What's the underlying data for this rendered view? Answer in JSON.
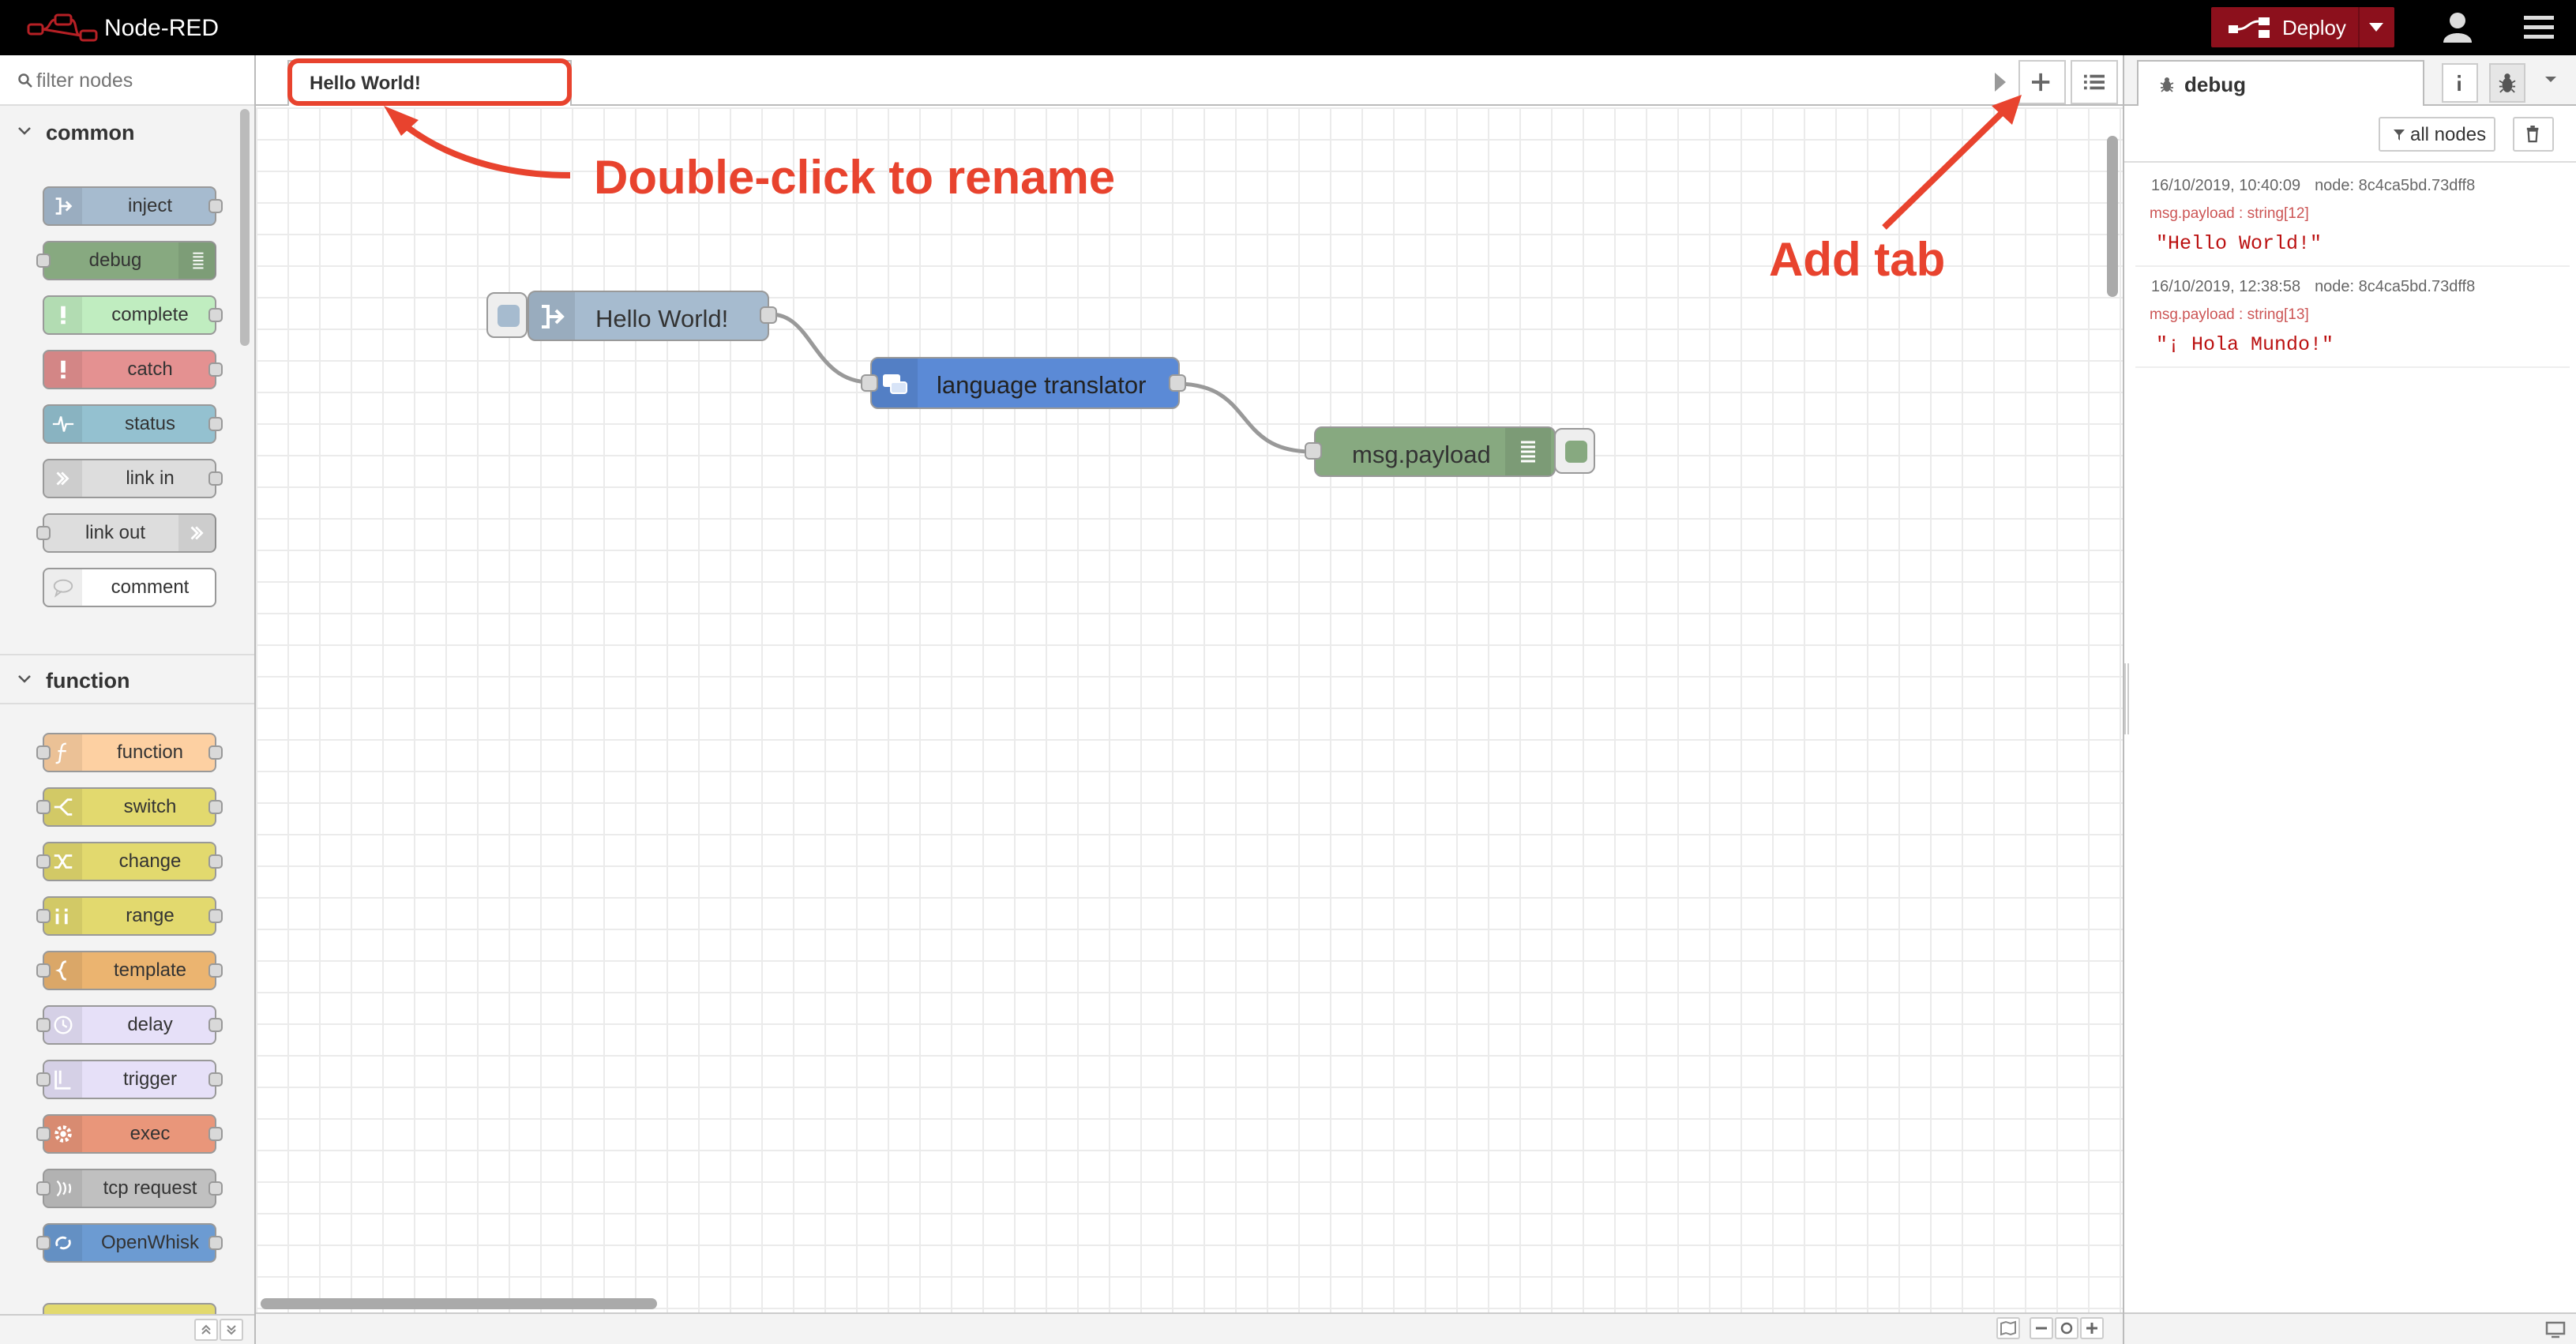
{
  "header": {
    "title": "Node-RED",
    "deploy_label": "Deploy",
    "deploy_color": "#8c101c"
  },
  "palette": {
    "filter_placeholder": "filter nodes",
    "categories": [
      {
        "name": "common",
        "nodes": [
          {
            "label": "inject",
            "color": "#a6bbcf",
            "icon": "arrow-in-icon"
          },
          {
            "label": "debug",
            "color": "#87a980",
            "icon": "list-icon"
          },
          {
            "label": "complete",
            "color": "#c0edc0",
            "icon": "exclamation-icon"
          },
          {
            "label": "catch",
            "color": "#e49191",
            "icon": "exclamation-icon"
          },
          {
            "label": "status",
            "color": "#94c1d0",
            "icon": "pulse-icon"
          },
          {
            "label": "link in",
            "color": "#dddddd",
            "icon": "link-icon"
          },
          {
            "label": "link out",
            "color": "#dddddd",
            "icon": "link-icon"
          },
          {
            "label": "comment",
            "color": "#ffffff",
            "icon": "comment-icon"
          }
        ]
      },
      {
        "name": "function",
        "nodes": [
          {
            "label": "function",
            "color": "#fdd0a2",
            "icon": "function-icon"
          },
          {
            "label": "switch",
            "color": "#e2d96e",
            "icon": "switch-icon"
          },
          {
            "label": "change",
            "color": "#e2d96e",
            "icon": "shuffle-icon"
          },
          {
            "label": "range",
            "color": "#e2d96e",
            "icon": "range-icon"
          },
          {
            "label": "template",
            "color": "#ebb470",
            "icon": "brace-icon"
          },
          {
            "label": "delay",
            "color": "#e6e0f8",
            "icon": "timer-icon"
          },
          {
            "label": "trigger",
            "color": "#e6e0f8",
            "icon": "trigger-icon"
          },
          {
            "label": "exec",
            "color": "#e9967a",
            "icon": "cog-icon"
          },
          {
            "label": "tcp request",
            "color": "#c0c0c0",
            "icon": "bridge-icon"
          },
          {
            "label": "OpenWhisk",
            "color": "#6c9bd2",
            "icon": "whisk-icon"
          }
        ]
      }
    ]
  },
  "workspace": {
    "active_tab": "Hello World!",
    "flow_nodes": {
      "inject_label": "Hello World!",
      "translator_label": "language translator",
      "debug_label": "msg.payload"
    },
    "annotations": {
      "rename_hint": "Double-click to rename",
      "add_tab_hint": "Add tab",
      "color": "#e8432e"
    }
  },
  "sidebar": {
    "tab_label": "debug",
    "filter_label": "all nodes",
    "messages": [
      {
        "timestamp": "16/10/2019, 10:40:09",
        "node": "node: 8c4ca5bd.73dff8",
        "topic": "msg.payload : string[12]",
        "value": "\"Hello World!\""
      },
      {
        "timestamp": "16/10/2019, 12:38:58",
        "node": "node: 8c4ca5bd.73dff8",
        "topic": "msg.payload : string[13]",
        "value": "\"¡ Hola Mundo!\""
      }
    ]
  }
}
